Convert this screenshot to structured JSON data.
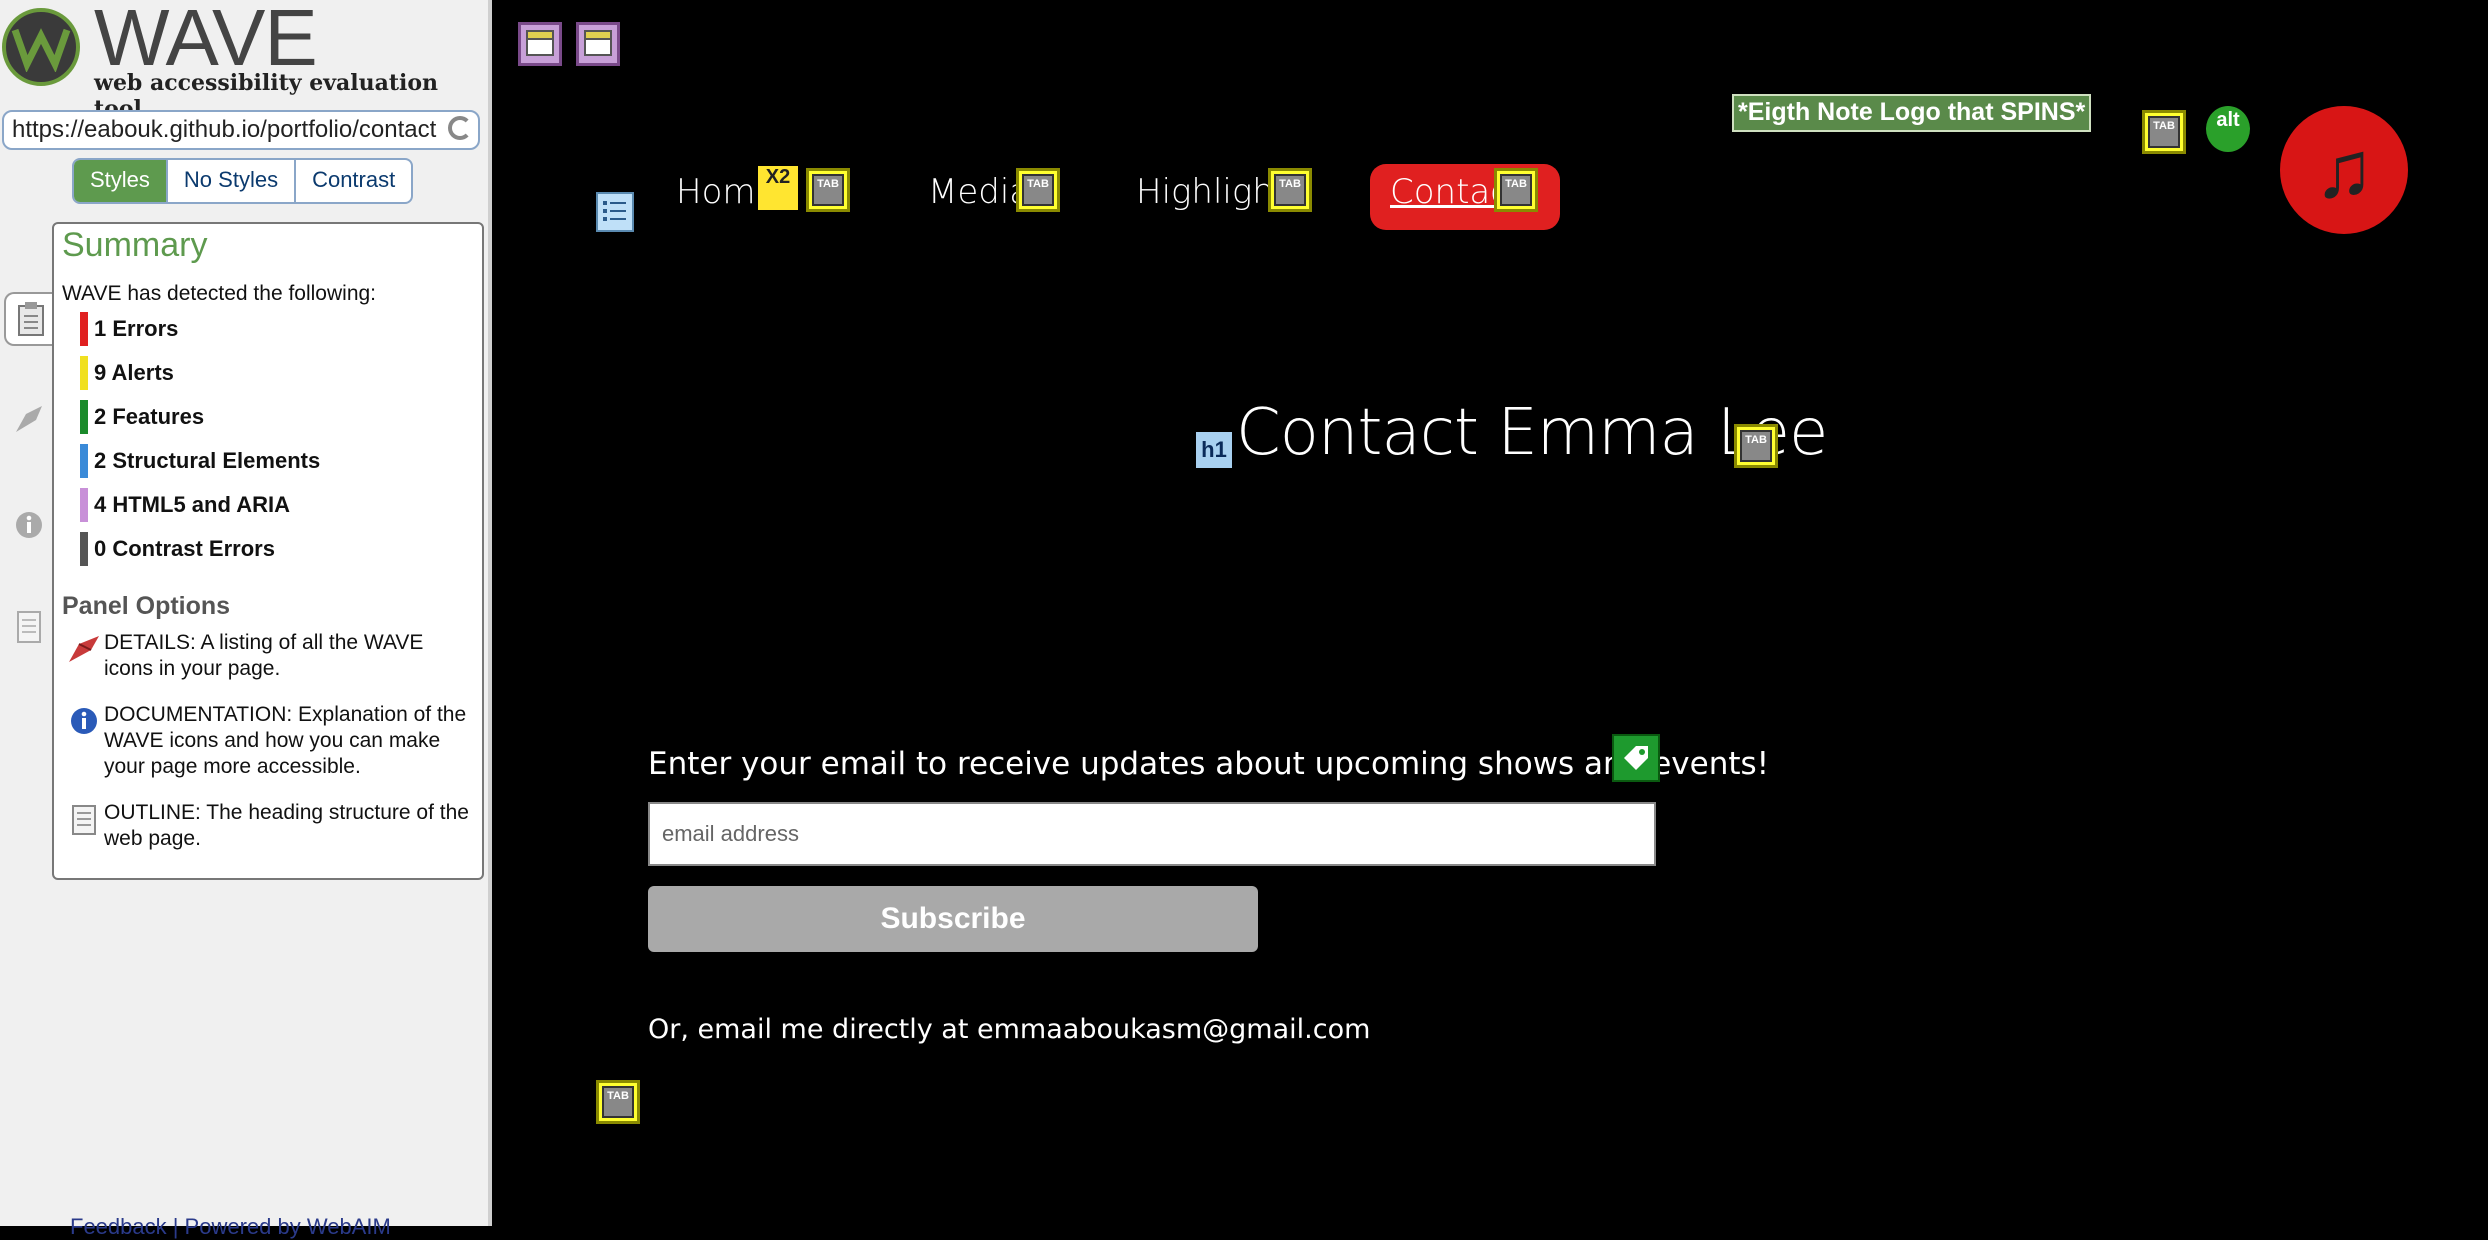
{
  "sidebar": {
    "logo": {
      "word": "WAVE",
      "tagline": "web accessibility evaluation tool"
    },
    "url": "https://eabouk.github.io/portfolio/contact",
    "view_tabs": [
      "Styles",
      "No Styles",
      "Contrast"
    ],
    "summary": {
      "title": "Summary",
      "detected": "WAVE has detected the following:",
      "items": [
        {
          "label": "1 Errors",
          "color": "#e02020"
        },
        {
          "label": "9 Alerts",
          "color": "#f0e020"
        },
        {
          "label": "2 Features",
          "color": "#1a8a2a"
        },
        {
          "label": "2 Structural Elements",
          "color": "#3a8ad8"
        },
        {
          "label": "4 HTML5 and ARIA",
          "color": "#c890d8"
        },
        {
          "label": "0 Contrast Errors",
          "color": "#555555"
        }
      ],
      "panel_options_title": "Panel Options",
      "options": [
        {
          "icon": "flag-icon",
          "text": "DETAILS: A listing of all the WAVE icons in your page."
        },
        {
          "icon": "info-icon",
          "text": "DOCUMENTATION: Explanation of the WAVE icons and how you can make your page more accessible."
        },
        {
          "icon": "outline-icon",
          "text": "OUTLINE: The heading structure of the web page."
        }
      ]
    },
    "feedback": "Feedback | Powered by WebAIM"
  },
  "page": {
    "nav": [
      "Home",
      "Media",
      "Highlights",
      "Contact"
    ],
    "alt_text": "*Eigth Note Logo that SPINS*",
    "alt_badge": "alt",
    "x2_badge": "X2",
    "logo_glyph": "♫",
    "h1_badge": "h1",
    "heading": "Contact Emma Lee",
    "form_label": "Enter your email to receive updates about upcoming shows and events!",
    "email_placeholder": "email address",
    "subscribe_label": "Subscribe",
    "direct_email": "Or, email me directly at emmaaboukasm@gmail.com",
    "tab_badge": "TAB"
  }
}
